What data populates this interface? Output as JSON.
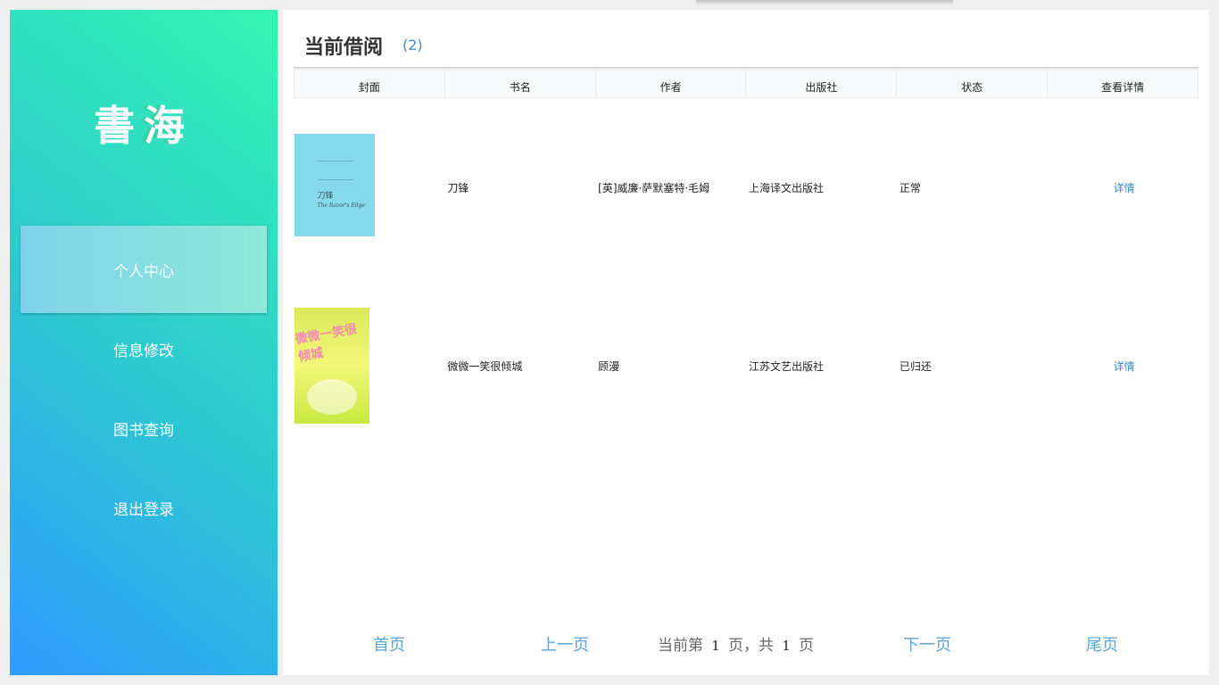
{
  "sidebar": {
    "logo": {
      "char1": "書",
      "char2": "海"
    },
    "items": [
      {
        "label": "个人中心"
      },
      {
        "label": "信息修改"
      },
      {
        "label": "图书查询"
      },
      {
        "label": "退出登录"
      }
    ],
    "active_index": 0
  },
  "main": {
    "title": "当前借阅",
    "count": "(2)",
    "table": {
      "headers": [
        "封面",
        "书名",
        "作者",
        "出版社",
        "状态",
        "查看详情"
      ],
      "rows": [
        {
          "cover": {
            "title": "刀锋",
            "subtitle": "The Razor's Edge"
          },
          "name": "刀锋",
          "author": "[英]威廉·萨默塞特·毛姆",
          "publisher": "上海译文出版社",
          "status": "正常",
          "detail": "详情"
        },
        {
          "cover": {
            "title": "微微一笑很倾城"
          },
          "name": "微微一笑很倾城",
          "author": "顾漫",
          "publisher": "江苏文艺出版社",
          "status": "已归还",
          "detail": "详情"
        }
      ]
    }
  },
  "pagination": {
    "first": "首页",
    "prev": "上一页",
    "current_prefix": "当前第",
    "current_page": "1",
    "middle": "页，共",
    "total_pages": "1",
    "suffix": "页",
    "next": "下一页",
    "last": "尾页"
  }
}
